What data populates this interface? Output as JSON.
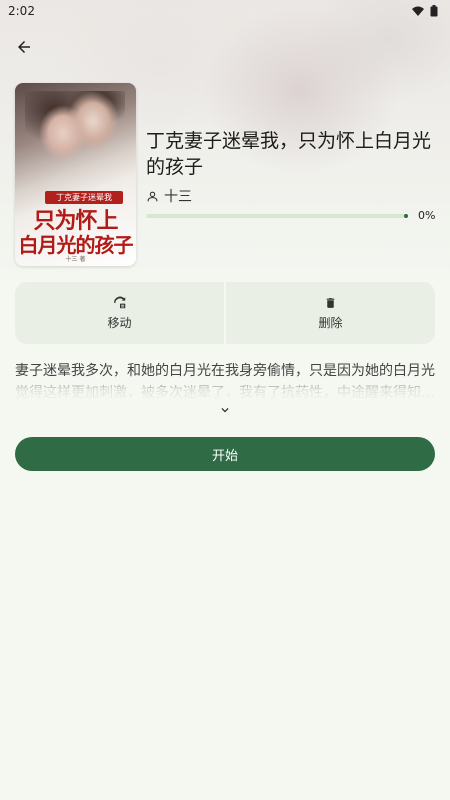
{
  "status_bar": {
    "time": "2:02"
  },
  "book": {
    "title": "丁克妻子迷晕我，只为怀上白月光的孩子",
    "author": "十三",
    "progress": 0,
    "progress_text": "0%",
    "cover": {
      "band_text": "丁克妻子迷晕我",
      "line1": "只为怀上",
      "line2": "白月光的孩子",
      "author": "十三 著"
    },
    "description": "妻子迷晕我多次，和她的白月光在我身旁偷情，只是因为她的白月光觉得这样更加刺激，被多次迷晕了，我有了抗药性，中途醒来得知…"
  },
  "actions": {
    "move_label": "移动",
    "delete_label": "删除",
    "start_label": "开始"
  },
  "colors": {
    "primary": "#2f6b45",
    "track": "#d7e8d2",
    "surface": "#e9efe5",
    "background": "#f4f8f1"
  }
}
